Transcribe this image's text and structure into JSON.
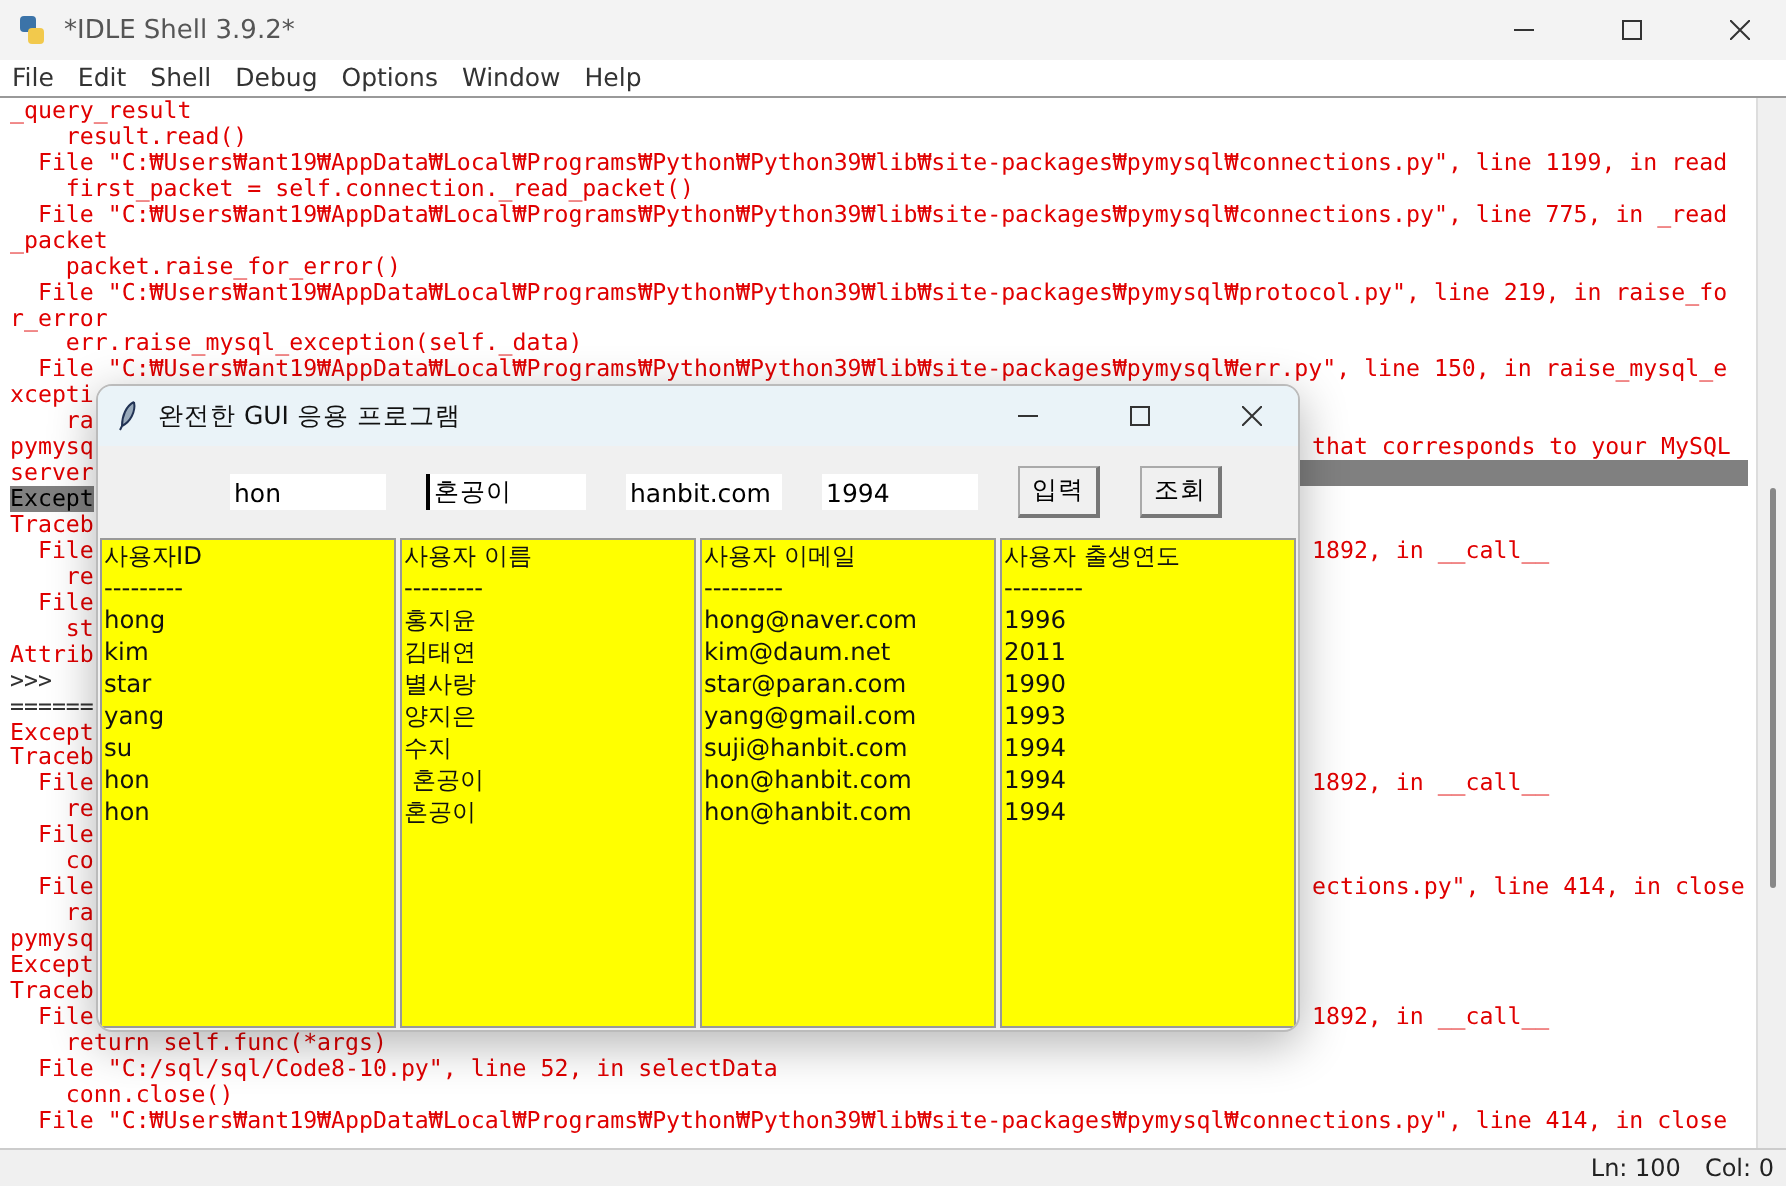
{
  "window": {
    "title": "*IDLE Shell 3.9.2*"
  },
  "menu": [
    "File",
    "Edit",
    "Shell",
    "Debug",
    "Options",
    "Window",
    "Help"
  ],
  "shell": {
    "lines": [
      {
        "kind": "error",
        "text": "_query_result",
        "selected": false
      },
      {
        "kind": "error",
        "text": "    result.read()",
        "selected": false
      },
      {
        "kind": "error",
        "text": "  File \"C:₩Users₩ant19₩AppData₩Local₩Programs₩Python₩Python39₩lib₩site-packages₩pymysql₩connections.py\", line 1199, in read",
        "selected": false
      },
      {
        "kind": "error",
        "text": "    first_packet = self.connection._read_packet()",
        "selected": false
      },
      {
        "kind": "error",
        "text": "  File \"C:₩Users₩ant19₩AppData₩Local₩Programs₩Python₩Python39₩lib₩site-packages₩pymysql₩connections.py\", line 775, in _read",
        "selected": false
      },
      {
        "kind": "error",
        "text": "_packet",
        "selected": false
      },
      {
        "kind": "error",
        "text": "    packet.raise_for_error()",
        "selected": false
      },
      {
        "kind": "error",
        "text": "  File \"C:₩Users₩ant19₩AppData₩Local₩Programs₩Python₩Python39₩lib₩site-packages₩pymysql₩protocol.py\", line 219, in raise_fo",
        "selected": false
      },
      {
        "kind": "error",
        "text": "r_error",
        "selected": false
      },
      {
        "kind": "error",
        "text": "    err.raise_mysql_exception(self._data)",
        "selected": false
      },
      {
        "kind": "error",
        "text": "  File \"C:₩Users₩ant19₩AppData₩Local₩Programs₩Python₩Python39₩lib₩site-packages₩pymysql₩err.py\", line 150, in raise_mysql_e",
        "selected": false
      },
      {
        "kind": "error",
        "text": "xcepti",
        "selected": false
      },
      {
        "kind": "error",
        "text": "    ra",
        "selected": false
      },
      {
        "kind": "error",
        "text": "pymysq",
        "selected": false,
        "right": "that corresponds to your MySQL",
        "right_selected": false
      },
      {
        "kind": "error",
        "text": "server",
        "selected": false,
        "right_selected": true
      },
      {
        "kind": "error",
        "text": "Except",
        "selected": true
      },
      {
        "kind": "error",
        "text": "Traceb",
        "selected": false
      },
      {
        "kind": "error",
        "text": "  File",
        "selected": false,
        "right": "1892, in __call__",
        "right_selected": false
      },
      {
        "kind": "error",
        "text": "    re",
        "selected": false
      },
      {
        "kind": "error",
        "text": "  File",
        "selected": false
      },
      {
        "kind": "error",
        "text": "    st",
        "selected": false
      },
      {
        "kind": "error",
        "text": "Attrib",
        "selected": false
      },
      {
        "kind": "prompt",
        "text": ">>>",
        "selected": false
      },
      {
        "kind": "prompt",
        "text": "======",
        "selected": false
      },
      {
        "kind": "error",
        "text": "Except",
        "selected": false
      },
      {
        "kind": "error",
        "text": "Traceb",
        "selected": false
      },
      {
        "kind": "error",
        "text": "  File",
        "selected": false,
        "right": "1892, in __call__",
        "right_selected": false
      },
      {
        "kind": "error",
        "text": "    re",
        "selected": false
      },
      {
        "kind": "error",
        "text": "  File",
        "selected": false
      },
      {
        "kind": "error",
        "text": "    co",
        "selected": false
      },
      {
        "kind": "error",
        "text": "  File",
        "selected": false,
        "right": "ections.py\", line 414, in close",
        "right_selected": false
      },
      {
        "kind": "error",
        "text": "    ra",
        "selected": false
      },
      {
        "kind": "error",
        "text": "pymysq",
        "selected": false
      },
      {
        "kind": "error",
        "text": "Except",
        "selected": false
      },
      {
        "kind": "error",
        "text": "Traceb",
        "selected": false
      },
      {
        "kind": "error",
        "text": "  File",
        "selected": false,
        "right": "1892, in __call__",
        "right_selected": false
      },
      {
        "kind": "error",
        "text": "    return self.func(*args)",
        "selected": false
      },
      {
        "kind": "error",
        "text": "  File \"C:/sql/sql/Code8-10.py\", line 52, in selectData",
        "selected": false
      },
      {
        "kind": "error",
        "text": "    conn.close()",
        "selected": false
      },
      {
        "kind": "error",
        "text": "  File \"C:₩Users₩ant19₩AppData₩Local₩Programs₩Python₩Python39₩lib₩site-packages₩pymysql₩connections.py\", line 414, in close",
        "selected": false
      }
    ]
  },
  "status_bar": {
    "line": "Ln: 100",
    "column": "Col: 0"
  },
  "dialog": {
    "title": "완전한 GUI 응용 프로그램",
    "inputs": [
      {
        "value": "hon",
        "focused": false
      },
      {
        "value": "혼공이",
        "focused": true
      },
      {
        "value": "hanbit.com",
        "focused": false
      },
      {
        "value": "1994",
        "focused": false
      }
    ],
    "buttons": [
      "입력",
      "조회"
    ],
    "columns": [
      {
        "items": [
          "사용자ID",
          "---------",
          "hong",
          "kim",
          "star",
          "yang",
          "su",
          "hon",
          "hon"
        ]
      },
      {
        "items": [
          "사용자 이름",
          "---------",
          "홍지윤",
          "김태연",
          "별사랑",
          "양지은",
          "수지",
          " 혼공이",
          "혼공이"
        ]
      },
      {
        "items": [
          "사용자 이메일",
          "---------",
          "hong@naver.com",
          "kim@daum.net",
          "star@paran.com",
          "yang@gmail.com",
          "suji@hanbit.com",
          "hon@hanbit.com",
          "hon@hanbit.com"
        ]
      },
      {
        "items": [
          "사용자 출생연도",
          "---------",
          "1996",
          "2011",
          "1990",
          "1993",
          "1994",
          "1994",
          "1994"
        ]
      }
    ]
  }
}
